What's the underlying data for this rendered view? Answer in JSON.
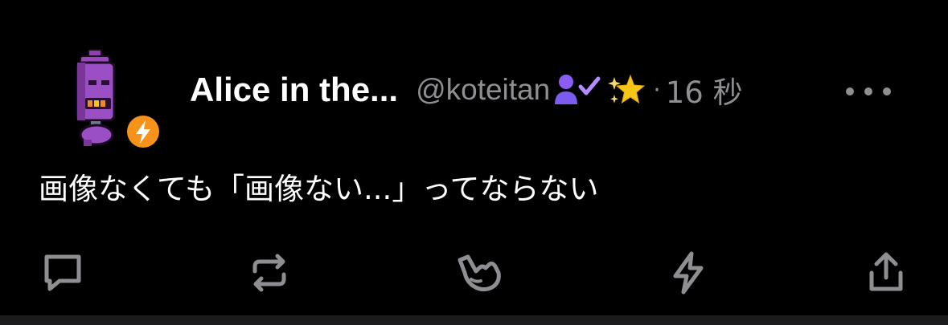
{
  "post": {
    "display_name": "Alice in the...",
    "handle": "@koteitan",
    "separator": "·",
    "time": "16 秒",
    "content": "画像なくても「画像ない...」ってならない"
  },
  "icons": {
    "avatar": "robot-avatar",
    "avatar_badge": "lightning-badge-icon",
    "follow_badge": "person-check-icon",
    "sparkle_badge": "sparkles-icon",
    "more": "more-dots-icon",
    "actions": [
      "reply-icon",
      "repost-icon",
      "shaka-icon",
      "zap-icon",
      "share-icon"
    ]
  },
  "colors": {
    "background": "#000000",
    "text": "#ffffff",
    "muted": "#8e8e93",
    "badge_orange": "#f7931a",
    "accent_purple": "#8b5cf6",
    "star_yellow": "#f5c518"
  }
}
